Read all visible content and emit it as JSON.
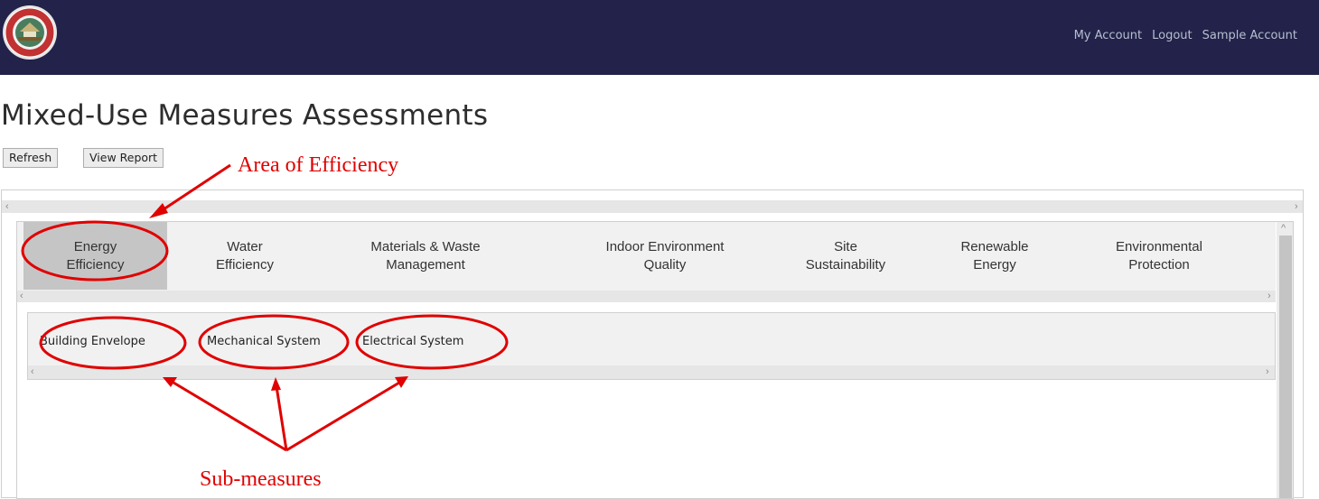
{
  "header": {
    "logo_name": "city-seal-logo",
    "nav": [
      "My Account",
      "Logout",
      "Sample Account"
    ]
  },
  "page": {
    "title": "Mixed-Use Measures Assessments",
    "refresh_label": "Refresh",
    "view_report_label": "View Report"
  },
  "areas": {
    "active_index": 0,
    "items": [
      {
        "line1": "Energy",
        "line2": "Efficiency"
      },
      {
        "line1": "Water",
        "line2": "Efficiency"
      },
      {
        "line1": "Materials & Waste",
        "line2": "Management"
      },
      {
        "line1": "Indoor Environment",
        "line2": "Quality"
      },
      {
        "line1": "Site",
        "line2": "Sustainability"
      },
      {
        "line1": "Renewable",
        "line2": "Energy"
      },
      {
        "line1": "Environmental",
        "line2": "Protection"
      }
    ]
  },
  "sub_measures": {
    "items": [
      "Building Envelope",
      "Mechanical System",
      "Electrical System"
    ]
  },
  "annotations": {
    "area_label": "Area of Efficiency",
    "sub_label": "Sub-measures",
    "color": "#e00000"
  },
  "scroll_glyphs": {
    "left": "‹",
    "right": "›",
    "up": "^"
  },
  "colors": {
    "header_bg": "#22224a",
    "nav_text": "#b8bfd0",
    "active_tab_bg": "#c5c5c5"
  }
}
